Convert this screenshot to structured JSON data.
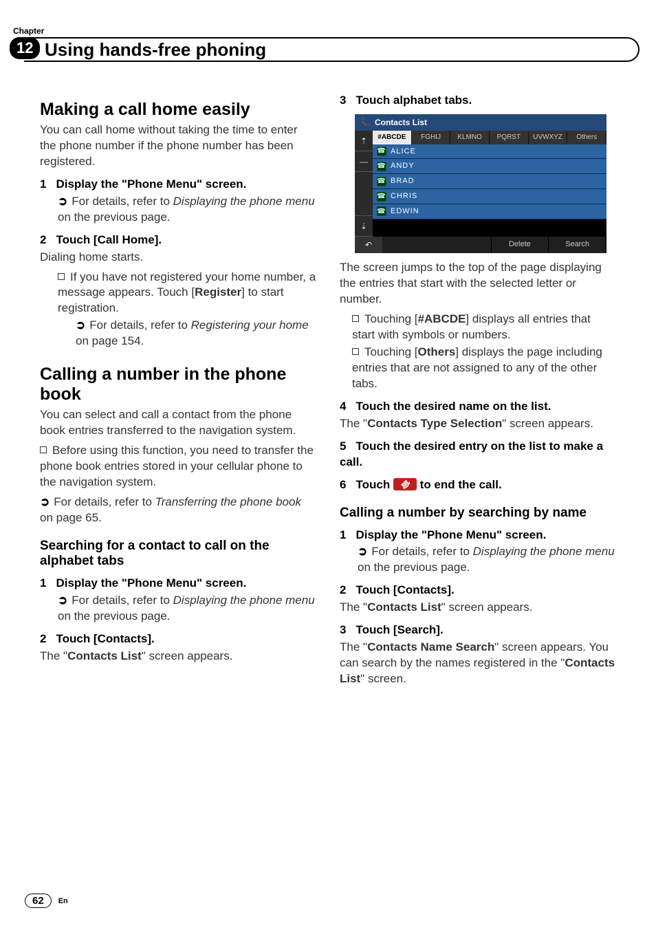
{
  "chapter_label": "Chapter",
  "chapter_number": "12",
  "page_title": "Using hands-free phoning",
  "page_number": "62",
  "page_lang": "En",
  "left": {
    "h1": "Making a call home easily",
    "p1": "You can call home without taking the time to enter the phone number if the phone number has been registered.",
    "step1_num": "1",
    "step1_txt": "Display the \"Phone Menu\" screen.",
    "step1_ref_pre": "For details, refer to ",
    "step1_ref_em": "Displaying the phone menu",
    "step1_ref_post": " on the previous page.",
    "step2_num": "2",
    "step2_txt": "Touch [Call Home].",
    "step2_body": "Dialing home starts.",
    "step2_note_pre": "If you have not registered your home number, a message appears. Touch [",
    "step2_note_bold": "Register",
    "step2_note_post": "] to start registration.",
    "step2_subref_pre": "For details, refer to ",
    "step2_subref_em": "Registering your home",
    "step2_subref_post": " on page 154.",
    "h2": "Calling a number in the phone book",
    "p2": "You can select and call a contact from the phone book entries transferred to the navigation system.",
    "bullet1": "Before using this function, you need to transfer the phone book entries stored in your cellular phone to the navigation system.",
    "ref2_pre": "For details, refer to ",
    "ref2_em": "Transferring the phone book",
    "ref2_post": " on page 65.",
    "h3": "Searching for a contact to call on the alphabet tabs",
    "s3_step1_num": "1",
    "s3_step1_txt": "Display the \"Phone Menu\" screen.",
    "s3_step1_ref_pre": "For details, refer to ",
    "s3_step1_ref_em": "Displaying the phone menu",
    "s3_step1_ref_post": " on the previous page.",
    "s3_step2_num": "2",
    "s3_step2_txt": "Touch [Contacts].",
    "s3_step2_body_pre": "The \"",
    "s3_step2_body_bold": "Contacts List",
    "s3_step2_body_post": "\" screen appears."
  },
  "right": {
    "step3_num": "3",
    "step3_txt": "Touch alphabet tabs.",
    "screenshot": {
      "title": "Contacts List",
      "tabs": [
        "#ABCDE",
        "FGHIJ",
        "KLMNO",
        "PQRST",
        "UVWXYZ",
        "Others"
      ],
      "rows": [
        "ALICE",
        "ANDY",
        "BRAD",
        "CHRIS",
        "EDWIN"
      ],
      "side": [
        "⇡",
        "—",
        "⇣"
      ],
      "back": "↶",
      "btn_delete": "Delete",
      "btn_search": "Search"
    },
    "p1": "The screen jumps to the top of the page displaying the entries that start with the selected letter or number.",
    "bullet1_pre": "Touching [",
    "bullet1_bold": "#ABCDE",
    "bullet1_post": "] displays all entries that start with symbols or numbers.",
    "bullet2_pre": "Touching [",
    "bullet2_bold": "Others",
    "bullet2_post": "] displays the page including entries that are not assigned to any of the other tabs.",
    "step4_num": "4",
    "step4_txt": "Touch the desired name on the list.",
    "step4_body_pre": "The \"",
    "step4_body_bold": "Contacts Type Selection",
    "step4_body_post": "\" screen appears.",
    "step5_num": "5",
    "step5_txt": "Touch the desired entry on the list to make a call.",
    "step6_num": "6",
    "step6_pre": "Touch ",
    "step6_post": " to end the call.",
    "h3": "Calling a number by searching by name",
    "s2_step1_num": "1",
    "s2_step1_txt": "Display the \"Phone Menu\" screen.",
    "s2_step1_ref_pre": "For details, refer to ",
    "s2_step1_ref_em": "Displaying the phone menu",
    "s2_step1_ref_post": " on the previous page.",
    "s2_step2_num": "2",
    "s2_step2_txt": "Touch [Contacts].",
    "s2_step2_body_pre": "The \"",
    "s2_step2_body_bold": "Contacts List",
    "s2_step2_body_post": "\" screen appears.",
    "s2_step3_num": "3",
    "s2_step3_txt": "Touch [Search].",
    "s2_step3_body_pre": "The \"",
    "s2_step3_body_bold": "Contacts Name Search",
    "s2_step3_body_post": "\" screen appears. You can search by the names registered in the \"",
    "s2_step3_body_bold2": "Contacts List",
    "s2_step3_body_post2": "\" screen."
  }
}
